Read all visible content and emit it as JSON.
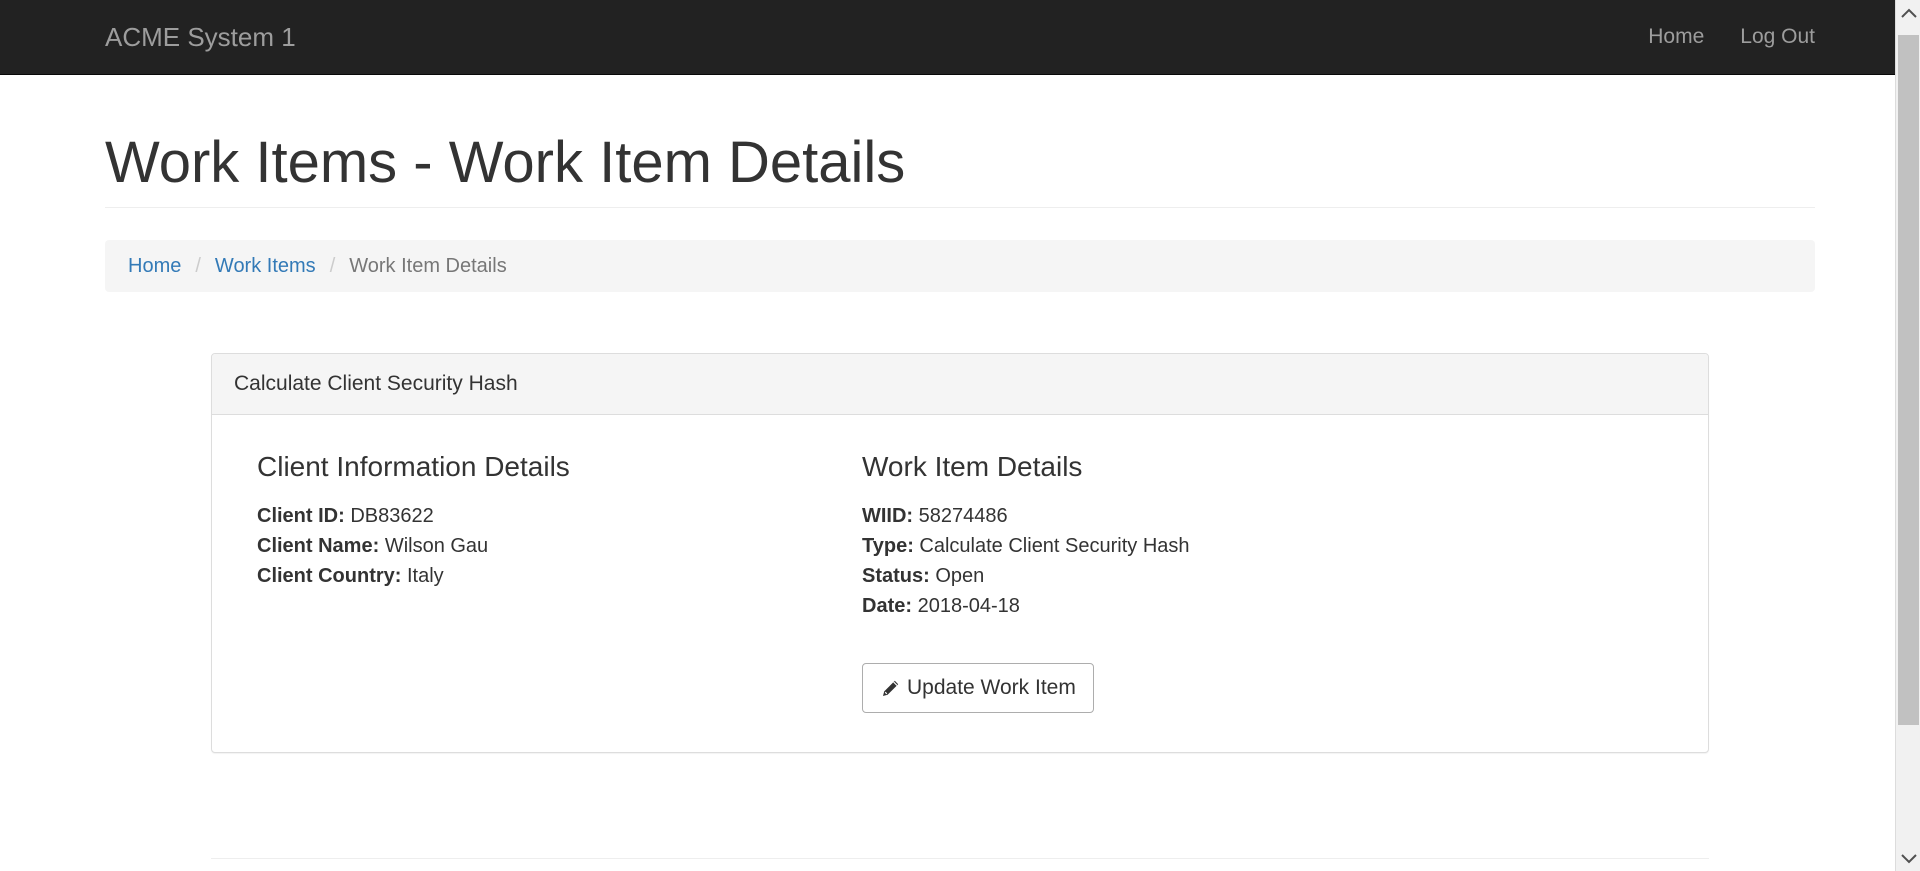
{
  "navbar": {
    "brand": "ACME System 1",
    "links": [
      {
        "label": "Home"
      },
      {
        "label": "Log Out"
      }
    ]
  },
  "header": {
    "title": "Work Items - Work Item Details"
  },
  "breadcrumb": {
    "items": [
      {
        "label": "Home"
      },
      {
        "label": "Work Items"
      }
    ],
    "separator": "/",
    "active": "Work Item Details"
  },
  "panel": {
    "heading": "Calculate Client Security Hash",
    "client": {
      "title": "Client Information Details",
      "fields": [
        {
          "label": "Client ID:",
          "value": "DB83622"
        },
        {
          "label": "Client Name:",
          "value": "Wilson Gau"
        },
        {
          "label": "Client Country:",
          "value": "Italy"
        }
      ]
    },
    "work_item": {
      "title": "Work Item Details",
      "fields": [
        {
          "label": "WIID:",
          "value": "58274486"
        },
        {
          "label": "Type:",
          "value": "Calculate Client Security Hash"
        },
        {
          "label": "Status:",
          "value": "Open"
        },
        {
          "label": "Date:",
          "value": "2018-04-18"
        }
      ],
      "update_button": {
        "label": "Update Work Item",
        "icon": "pencil-icon"
      }
    }
  },
  "colors": {
    "navbar_bg": "#222222",
    "navbar_text": "#9d9d9d",
    "link": "#337ab7",
    "breadcrumb_bg": "#f5f5f5",
    "panel_heading_bg": "#f5f5f5",
    "text": "#333333"
  }
}
